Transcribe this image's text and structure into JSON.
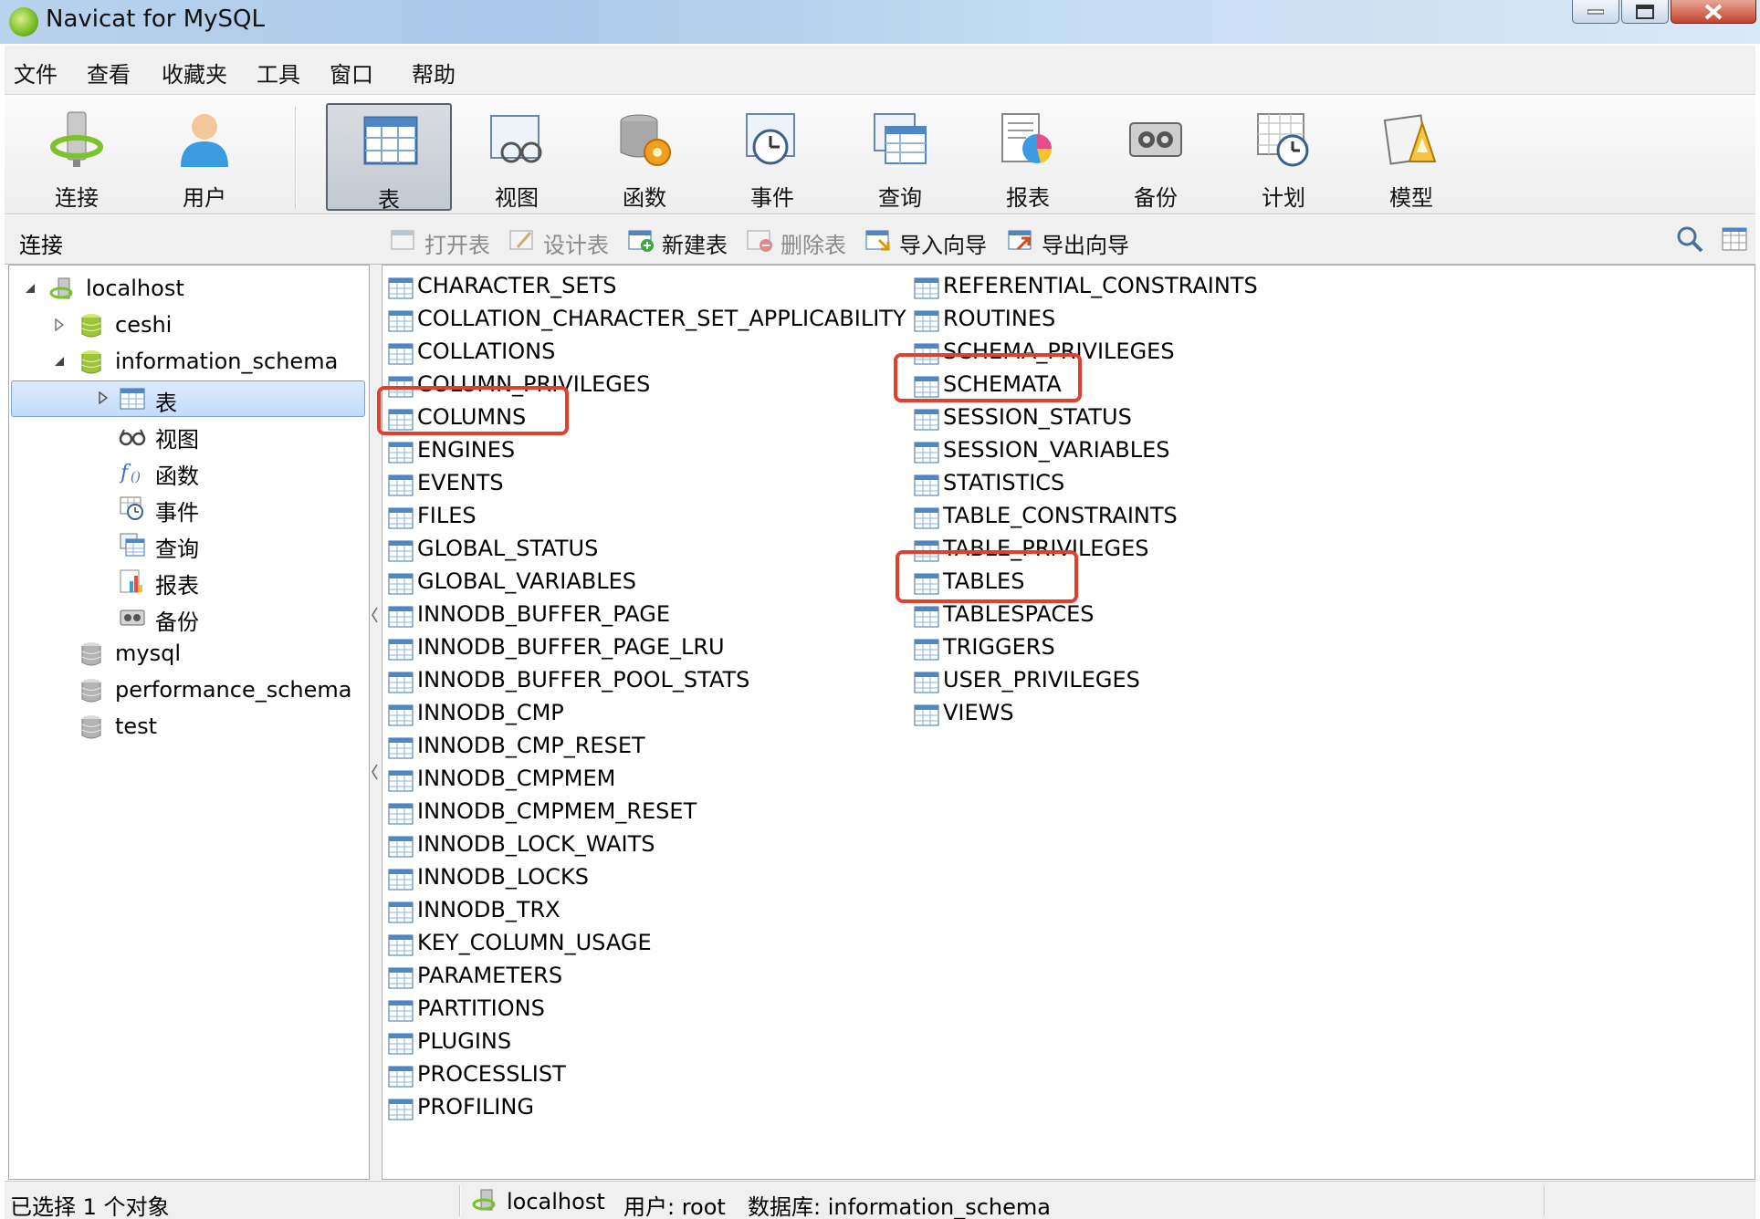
{
  "window": {
    "title": "Navicat for MySQL"
  },
  "menu": [
    "文件",
    "查看",
    "收藏夹",
    "工具",
    "窗口",
    "帮助"
  ],
  "toolbar": {
    "connect": "连接",
    "user": "用户",
    "table": "表",
    "view": "视图",
    "function": "函数",
    "event": "事件",
    "query": "查询",
    "report": "报表",
    "backup": "备份",
    "schedule": "计划",
    "model": "模型"
  },
  "subbar": {
    "section": "连接",
    "open": "打开表",
    "design": "设计表",
    "new": "新建表",
    "delete": "删除表",
    "import": "导入向导",
    "export": "导出向导"
  },
  "tree": {
    "connection": "localhost",
    "db_ceshi": "ceshi",
    "db_info": "information_schema",
    "node_tables": "表",
    "node_views": "视图",
    "node_functions": "函数",
    "node_events": "事件",
    "node_queries": "查询",
    "node_reports": "报表",
    "node_backups": "备份",
    "db_mysql": "mysql",
    "db_perf": "performance_schema",
    "db_test": "test"
  },
  "tables_col1": [
    "CHARACTER_SETS",
    "COLLATION_CHARACTER_SET_APPLICABILITY",
    "COLLATIONS",
    "COLUMN_PRIVILEGES",
    "COLUMNS",
    "ENGINES",
    "EVENTS",
    "FILES",
    "GLOBAL_STATUS",
    "GLOBAL_VARIABLES",
    "INNODB_BUFFER_PAGE",
    "INNODB_BUFFER_PAGE_LRU",
    "INNODB_BUFFER_POOL_STATS",
    "INNODB_CMP",
    "INNODB_CMP_RESET",
    "INNODB_CMPMEM",
    "INNODB_CMPMEM_RESET",
    "INNODB_LOCK_WAITS",
    "INNODB_LOCKS",
    "INNODB_TRX",
    "KEY_COLUMN_USAGE",
    "PARAMETERS",
    "PARTITIONS",
    "PLUGINS",
    "PROCESSLIST",
    "PROFILING"
  ],
  "tables_col2": [
    "REFERENTIAL_CONSTRAINTS",
    "ROUTINES",
    "SCHEMA_PRIVILEGES",
    "SCHEMATA",
    "SESSION_STATUS",
    "SESSION_VARIABLES",
    "STATISTICS",
    "TABLE_CONSTRAINTS",
    "TABLE_PRIVILEGES",
    "TABLES",
    "TABLESPACES",
    "TRIGGERS",
    "USER_PRIVILEGES",
    "VIEWS"
  ],
  "highlighted": [
    "COLUMNS",
    "SCHEMATA",
    "TABLES"
  ],
  "status": {
    "selection": "已选择 1 个对象",
    "connection": "localhost",
    "user": "用户: root",
    "database": "数据库: information_schema"
  },
  "colors": {
    "highlight": "#e0402e",
    "selection_bg": "#c1dcfa"
  }
}
